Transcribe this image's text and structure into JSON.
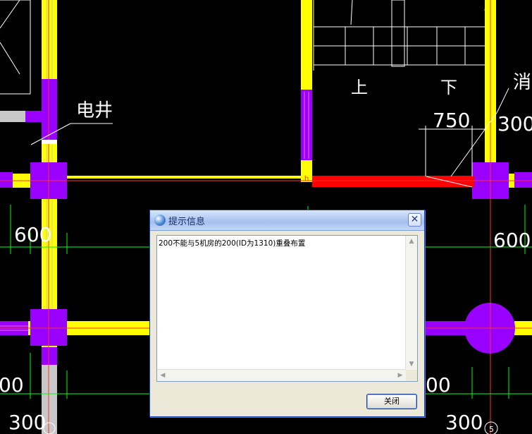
{
  "cad": {
    "labels": {
      "electric_shaft": "电井",
      "up": "上",
      "down": "下",
      "fire_partial": "消",
      "dim_750": "750",
      "dim_300_top": "300",
      "dim_600_left": "600",
      "dim_600_right": "600",
      "dim_00_left": "00",
      "dim_00_right": "00",
      "dim_300_bottom_left": "300",
      "dim_300_bottom_right": "300",
      "point_mark": "h",
      "bottom_number": "5"
    },
    "colors": {
      "background": "#000000",
      "wall_yellow": "#ffff00",
      "column_purple": "#9900ff",
      "grid_green": "#00ff00",
      "beam_red": "#ff0000",
      "axis_red": "#ff0000",
      "dim_white": "#ffffff",
      "wall_gray": "#c8c8c8"
    }
  },
  "dialog": {
    "title": "提示信息",
    "icon": "app-globe-icon",
    "close_icon": "close-icon",
    "message": "200不能与5机房的200(ID为1310)重叠布置",
    "close_button": "关闭"
  }
}
